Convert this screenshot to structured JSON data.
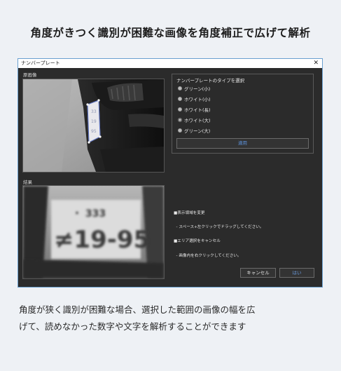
{
  "page": {
    "title": "角度がきつく識別が困難な画像を角度補正で広げて解析",
    "caption_line1": "角度が狭く識別が困難な場合、選択した範囲の画像の幅を広",
    "caption_line2": "げて、読めなかった数字や文字を解析することができます"
  },
  "window": {
    "title": "ナンバープレート",
    "close_glyph": "✕",
    "original_label": "原画像",
    "result_label": "結果",
    "plate_type_group": {
      "label": "ナンバープレートのタイプを選択",
      "options": [
        {
          "label": "グリーン(小)",
          "selected": false
        },
        {
          "label": "ホワイト(小)",
          "selected": false
        },
        {
          "label": "ホワイト(長)",
          "selected": false
        },
        {
          "label": "ホワイト(大)",
          "selected": true
        },
        {
          "label": "グリーン(大)",
          "selected": false
        }
      ],
      "apply_label": "適用"
    },
    "help_lines": [
      "■表示領域を変更",
      "  - スペース+左クリックでドラッグしてください。",
      "■エリア選択をキャンセル",
      "  - 画像内を右クリックしてください。"
    ],
    "cancel_label": "キャンセル",
    "ok_label": "はい",
    "result_plate": {
      "line1": "・ 333",
      "line2": "≠19-95"
    },
    "colors": {
      "accent": "#5b8fd6",
      "window_bg": "#2b2b2b",
      "border": "#6aa0d0"
    }
  }
}
